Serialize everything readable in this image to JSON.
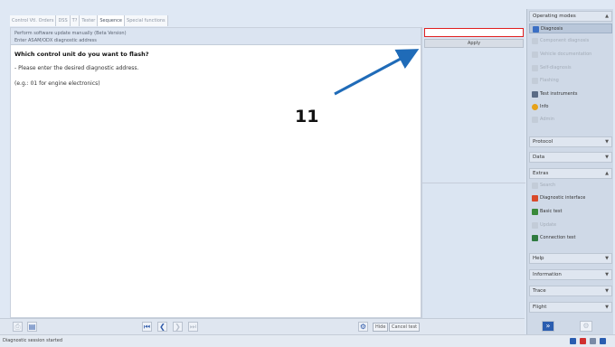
{
  "tabs": [
    "Control Vtl. Orders",
    "DSS",
    "T?",
    "Tester",
    "Sequence",
    "Special functions"
  ],
  "header": {
    "line1": "Perform software update manually (Beta Version)",
    "line2": "Enter ASAM/ODX diagnostic address"
  },
  "main": {
    "question": "Which control unit do you want to flash?",
    "instruction1": "- Please enter the desired diagnostic address.",
    "instruction2": "(e.g.: 01 for engine electronics)"
  },
  "input": {
    "value": "",
    "placeholder": ""
  },
  "apply_label": "Apply",
  "annotation": "11",
  "sidebar": {
    "operating_modes": "Operating modes",
    "items": [
      {
        "label": "Diagnosis",
        "icon": "diagnosis-icon",
        "disabled": false,
        "selected": true
      },
      {
        "label": "Component diagnosis",
        "icon": "component-icon",
        "disabled": true
      },
      {
        "label": "Vehicle documentation",
        "icon": "document-icon",
        "disabled": true
      },
      {
        "label": "Self-diagnosis",
        "icon": "self-diag-icon",
        "disabled": true
      },
      {
        "label": "Flashing",
        "icon": "flash-icon",
        "disabled": true
      },
      {
        "label": "Test instruments",
        "icon": "instrument-icon",
        "disabled": false
      },
      {
        "label": "Info",
        "icon": "info-icon",
        "disabled": false
      },
      {
        "label": "Admin",
        "icon": "admin-icon",
        "disabled": true
      }
    ],
    "sections": {
      "protocol": "Protocol",
      "data": "Data",
      "extras": "Extras",
      "help": "Help",
      "information": "Information",
      "trace": "Trace",
      "flight": "Flight"
    },
    "extras_items": [
      {
        "label": "Search",
        "icon": "search-icon",
        "disabled": true
      },
      {
        "label": "Diagnostic interface",
        "icon": "interface-icon",
        "disabled": false
      },
      {
        "label": "Basic test",
        "icon": "basic-test-icon",
        "disabled": false
      },
      {
        "label": "Update",
        "icon": "update-icon",
        "disabled": true
      },
      {
        "label": "Connection test",
        "icon": "connection-icon",
        "disabled": false
      }
    ]
  },
  "bottom": {
    "skip_label": "Hide",
    "cancel_label": "Cancel test"
  },
  "status": {
    "text": "Diagnostic session started"
  },
  "colors": {
    "accent": "#2a5db0",
    "input_border": "#e02020",
    "arrow": "#1f6bb8"
  }
}
